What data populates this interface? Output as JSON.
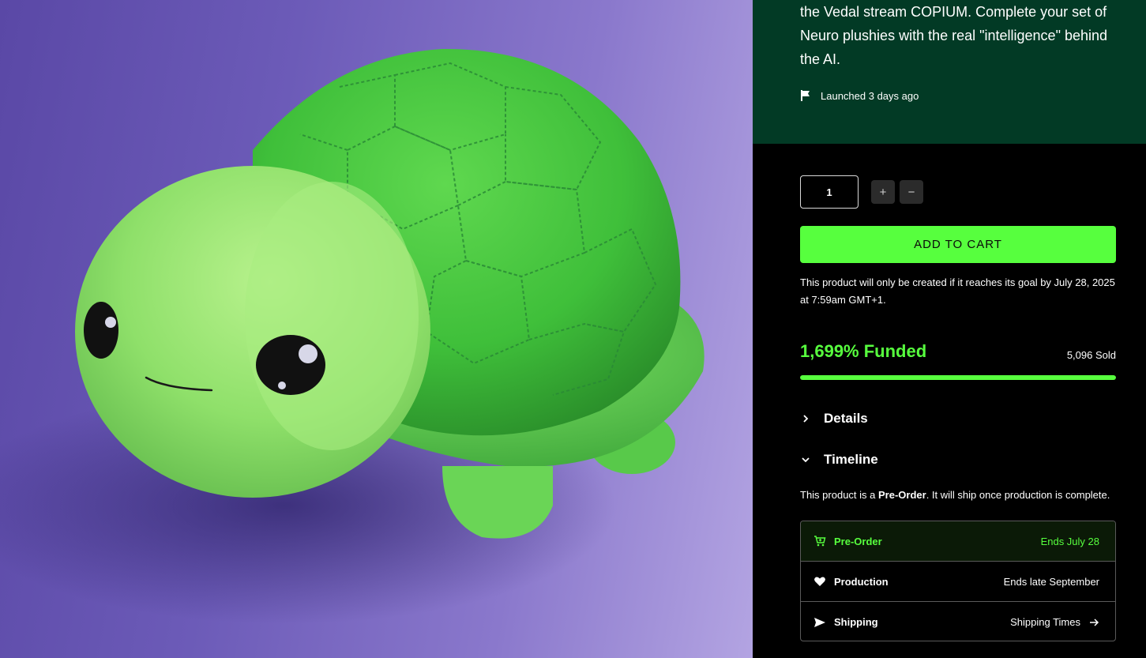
{
  "product": {
    "description": "the Vedal stream COPIUM. Complete your set of Neuro plushies with the real \"intelligence\" behind the AI.",
    "launched": "Launched 3 days ago"
  },
  "cart": {
    "quantity": "1",
    "plus": "+",
    "minus": "−",
    "add_to_cart": "ADD TO CART",
    "goal_note": "This product will only be created if it reaches its goal by July 28, 2025 at 7:59am GMT+1."
  },
  "funding": {
    "funded_label": "1,699% Funded",
    "sold_label": "5,096 Sold",
    "progress_fraction": 1.0,
    "accent_color": "#57ff3e"
  },
  "accordion": {
    "details": "Details",
    "timeline": "Timeline"
  },
  "timeline": {
    "intro_pre": "This product is a ",
    "intro_bold": "Pre-Order",
    "intro_post": ". It will ship once production is complete.",
    "steps": [
      {
        "name": "Pre-Order",
        "when": "Ends July 28",
        "icon": "cart-icon"
      },
      {
        "name": "Production",
        "when": "Ends late September",
        "icon": "heart-icon"
      },
      {
        "name": "Shipping",
        "when": "Shipping Times",
        "icon": "send-icon"
      }
    ]
  },
  "colors": {
    "description_bg": "#023a25",
    "image_bg": "#6c5bb8"
  }
}
